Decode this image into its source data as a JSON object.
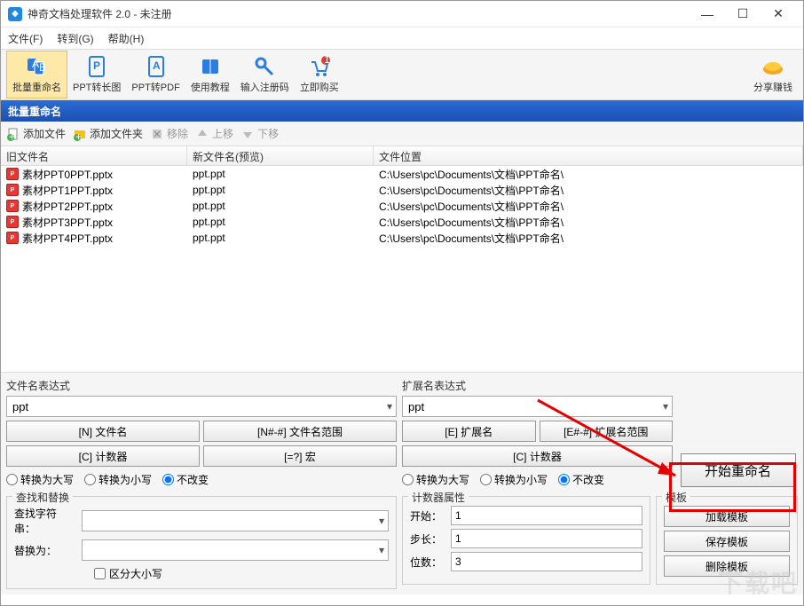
{
  "window": {
    "title": "神奇文档处理软件 2.0 - 未注册"
  },
  "menu": {
    "file": "文件(F)",
    "goto": "转到(G)",
    "help": "帮助(H)"
  },
  "toolbar": {
    "rename": "批量重命名",
    "ppt_long": "PPT转长图",
    "ppt_pdf": "PPT转PDF",
    "tutorial": "使用教程",
    "reg": "输入注册码",
    "buy": "立即购买",
    "share": "分享赚钱"
  },
  "section": {
    "title": "批量重命名"
  },
  "actions": {
    "add_file": "添加文件",
    "add_folder": "添加文件夹",
    "remove": "移除",
    "move_up": "上移",
    "move_down": "下移"
  },
  "table": {
    "headers": {
      "old": "旧文件名",
      "new": "新文件名(预览)",
      "loc": "文件位置"
    },
    "rows": [
      {
        "old": "素材PPT0PPT.pptx",
        "new": "ppt.ppt",
        "loc": "C:\\Users\\pc\\Documents\\文档\\PPT命名\\"
      },
      {
        "old": "素材PPT1PPT.pptx",
        "new": "ppt.ppt",
        "loc": "C:\\Users\\pc\\Documents\\文档\\PPT命名\\"
      },
      {
        "old": "素材PPT2PPT.pptx",
        "new": "ppt.ppt",
        "loc": "C:\\Users\\pc\\Documents\\文档\\PPT命名\\"
      },
      {
        "old": "素材PPT3PPT.pptx",
        "new": "ppt.ppt",
        "loc": "C:\\Users\\pc\\Documents\\文档\\PPT命名\\"
      },
      {
        "old": "素材PPT4PPT.pptx",
        "new": "ppt.ppt",
        "loc": "C:\\Users\\pc\\Documents\\文档\\PPT命名\\"
      }
    ]
  },
  "filename_expr": {
    "label": "文件名表达式",
    "value": "ppt",
    "btn_name": "[N] 文件名",
    "btn_range": "[N#-#] 文件名范围",
    "btn_counter": "[C] 计数器",
    "btn_macro": "[=?] 宏",
    "radio_upper": "转换为大写",
    "radio_lower": "转换为小写",
    "radio_none": "不改变"
  },
  "ext_expr": {
    "label": "扩展名表达式",
    "value": "ppt",
    "btn_ext": "[E] 扩展名",
    "btn_range": "[E#-#] 扩展名范围",
    "btn_counter": "[C] 计数器",
    "radio_upper": "转换为大写",
    "radio_lower": "转换为小写",
    "radio_none": "不改变"
  },
  "start_btn": "开始重命名",
  "search": {
    "legend": "查找和替换",
    "find_label": "查找字符串：",
    "replace_label": "替换为：",
    "case_label": "区分大小写"
  },
  "counter": {
    "legend": "计数器属性",
    "start_label": "开始：",
    "start_value": "1",
    "step_label": "步长：",
    "step_value": "1",
    "digits_label": "位数：",
    "digits_value": "3"
  },
  "template": {
    "legend": "模板",
    "load": "加载模板",
    "save": "保存模板",
    "delete": "删除模板"
  },
  "watermark": "下载吧"
}
